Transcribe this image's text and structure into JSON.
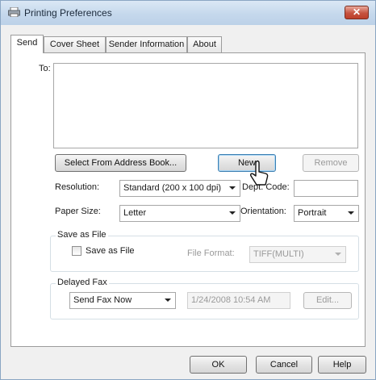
{
  "window": {
    "title": "Printing Preferences",
    "close_label": "✕"
  },
  "tabs": [
    {
      "label": "Send"
    },
    {
      "label": "Cover Sheet"
    },
    {
      "label": "Sender Information"
    },
    {
      "label": "About"
    }
  ],
  "send": {
    "to_label": "To:",
    "select_address_book": "Select From Address Book...",
    "new": "New",
    "remove": "Remove",
    "resolution_label": "Resolution:",
    "resolution_value": "Standard (200 x 100 dpi)",
    "dept_code_label": "Dept. Code:",
    "dept_code_value": "",
    "paper_size_label": "Paper Size:",
    "paper_size_value": "Letter",
    "orientation_label": "Orientation:",
    "orientation_value": "Portrait",
    "save_as_file_group": "Save as File",
    "save_as_file_checkbox": "Save as File",
    "file_format_label": "File Format:",
    "file_format_value": "TIFF(MULTI)",
    "delayed_fax_group": "Delayed Fax",
    "send_fax_value": "Send Fax Now",
    "delayed_datetime": "1/24/2008 10:54 AM",
    "edit": "Edit..."
  },
  "footer": {
    "ok": "OK",
    "cancel": "Cancel",
    "help": "Help"
  }
}
